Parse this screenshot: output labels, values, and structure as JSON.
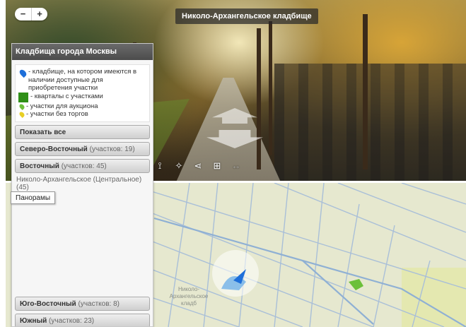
{
  "panorama": {
    "title": "Николо-Архангельское кладбище",
    "zoom_in": "+",
    "zoom_out": "−",
    "toolbar": [
      {
        "icon": "person-icon",
        "glyph": "⟟"
      },
      {
        "icon": "compass-icon",
        "glyph": "✧"
      },
      {
        "icon": "share-icon",
        "glyph": "⋖"
      },
      {
        "icon": "grid-icon",
        "glyph": "⊞"
      },
      {
        "icon": "expand-icon",
        "glyph": "↔"
      }
    ]
  },
  "sidebar": {
    "title": "Кладбища города Москвы",
    "legend": {
      "cemetery_available": "- кладбище, на котором имеются в наличии доступные для приобретения участки",
      "quarters_with_plots": "- кварталы с участками",
      "auction_plots": "- участки для аукциона",
      "no_auction_plots": "- участки без торгов"
    },
    "show_all": "Показать все",
    "districts_top": [
      {
        "name": "Северо-Восточный",
        "count": "(участков: 19)"
      },
      {
        "name": "Восточный",
        "count": "(участков: 45)"
      }
    ],
    "selected_cemetery": "Николо-Архангельское (Центральное) (45)",
    "districts_bottom": [
      {
        "name": "Юго-Восточный",
        "count": "(участков: 8)"
      },
      {
        "name": "Южный",
        "count": "(участков: 23)"
      }
    ]
  },
  "tooltip": "Панорамы",
  "map": {
    "label": "Николо-Архангельское кладб"
  },
  "colors": {
    "pin_blue": "#1e6fd9",
    "quarter_green": "#2f8f17",
    "auction_green": "#6cc03a",
    "no_auction_yellow": "#e8cf25",
    "map_background": "#e6e8cf",
    "map_lines": "#9fb8d6"
  }
}
